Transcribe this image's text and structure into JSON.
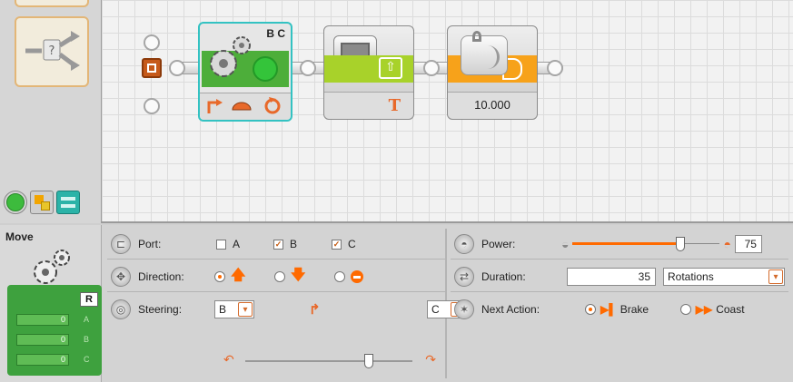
{
  "program": {
    "motor_block": {
      "ports_label": "B C"
    },
    "wait_block": {
      "value": "10.000"
    }
  },
  "config": {
    "block_title": "Move",
    "motor_panel": {
      "active_port": "R",
      "rows": [
        {
          "value": "0",
          "label": "A"
        },
        {
          "value": "0",
          "label": "B"
        },
        {
          "value": "0",
          "label": "C"
        }
      ]
    },
    "port": {
      "label": "Port:",
      "options": [
        {
          "name": "A",
          "checked": false
        },
        {
          "name": "B",
          "checked": true
        },
        {
          "name": "C",
          "checked": true
        }
      ]
    },
    "direction": {
      "label": "Direction:",
      "selected": "forward"
    },
    "steering": {
      "label": "Steering:",
      "left_port": "B",
      "right_port": "C",
      "level": 0.75
    },
    "power": {
      "label": "Power:",
      "value": "75",
      "level": 0.75
    },
    "duration": {
      "label": "Duration:",
      "value": "35",
      "unit": "Rotations"
    },
    "next_action": {
      "label": "Next Action:",
      "brake": "Brake",
      "coast": "Coast",
      "selected": "brake"
    }
  },
  "colors": {
    "accent_orange": "#ff6a00",
    "motor_green": "#3ea13e",
    "selection_teal": "#33c2c2"
  }
}
